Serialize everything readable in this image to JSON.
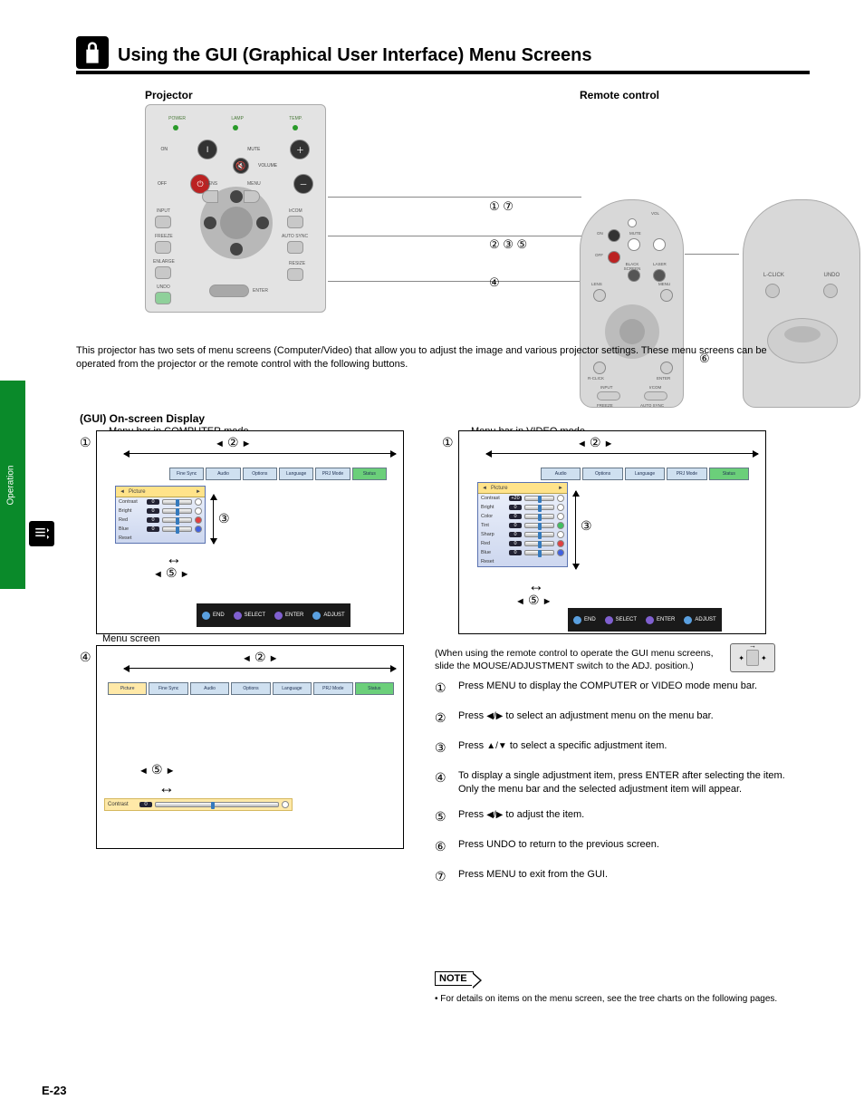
{
  "heading": "Using the GUI (Graphical User Interface) Menu Screens",
  "sidebar_label": "Operation",
  "devices": {
    "panel_caption": "Projector",
    "remote_caption": "Remote control"
  },
  "panel": {
    "status": [
      "POWER",
      "LAMP",
      "TEMP."
    ],
    "top_buttons": {
      "on": "ON",
      "mute": "MUTE",
      "volume": "VOLUME",
      "off": "OFF"
    },
    "mid_buttons": {
      "lens": "LENS",
      "menu": "MENU",
      "ircom": "IrCOM",
      "autosync": "AUTO SYNC"
    },
    "side_left": [
      "INPUT",
      "FREEZE",
      "ENLARGE",
      "UNDO"
    ],
    "side_right": [
      "RESIZE"
    ],
    "enter": "ENTER"
  },
  "remote_front": {
    "labels": [
      "VOL",
      "ON",
      "MUTE",
      "OFF",
      "BLACK SCREEN",
      "LASER",
      "LENS",
      "MENU",
      "R-CLICK",
      "ENTER",
      "INPUT",
      "IrCOM",
      "FREEZE",
      "AUTO SYNC"
    ]
  },
  "remote_back": {
    "lclick": "L-CLICK",
    "undo": "UNDO"
  },
  "callouts_left": [
    "①  ⑦",
    "②  ③  ⑤",
    "④"
  ],
  "callout6": "⑥",
  "gui_intro": [
    "This projector has two sets of menu screens (Computer/Video) that allow you to adjust the image and various projector settings. These menu screens can be operated from the projector or the remote control with the following buttons."
  ],
  "gui_caption_left": "(GUI) On-screen Display",
  "gui_caption_right": "Menu bar in VIDEO mode",
  "gui_caption_left_mode": "Menu bar in COMPUTER mode",
  "gui3_label": "Menu screen",
  "menu_tabs_computer": [
    "Picture",
    "Fine Sync",
    "Audio",
    "Options",
    "Language",
    "PRJ Mode",
    "Status"
  ],
  "menu_tabs_video": [
    "Picture",
    "Audio",
    "Options",
    "Language",
    "PRJ Mode",
    "Status"
  ],
  "osd_computer": {
    "title": "Picture",
    "rows": [
      {
        "name": "Contrast",
        "val": "0",
        "color": "#ffffff"
      },
      {
        "name": "Bright",
        "val": "0",
        "color": "#ffffff"
      },
      {
        "name": "Red",
        "val": "0",
        "color": "#e04040"
      },
      {
        "name": "Blue",
        "val": "0",
        "color": "#4060e0"
      },
      {
        "name": "Reset",
        "val": "",
        "color": ""
      }
    ]
  },
  "osd_video": {
    "title": "Picture",
    "rows": [
      {
        "name": "Contrast",
        "val": "+20",
        "color": "#ffffff"
      },
      {
        "name": "Bright",
        "val": "0",
        "color": "#ffffff"
      },
      {
        "name": "Color",
        "val": "0",
        "color": "#ffffff"
      },
      {
        "name": "Tint",
        "val": "0",
        "color": "#40c060"
      },
      {
        "name": "Sharp",
        "val": "0",
        "color": "#ffffff"
      },
      {
        "name": "Red",
        "val": "0",
        "color": "#e04040"
      },
      {
        "name": "Blue",
        "val": "0",
        "color": "#4060e0"
      },
      {
        "name": "Reset",
        "val": "",
        "color": ""
      }
    ]
  },
  "hint_bar": [
    {
      "icon": "#5aa0e0",
      "label": "END"
    },
    {
      "icon": "#8060d0",
      "label": "SELECT"
    },
    {
      "icon": "#8060d0",
      "label": "ENTER"
    },
    {
      "icon": "#5aa0e0",
      "label": "ADJUST"
    }
  ],
  "strip_single": {
    "name": "Contrast",
    "val": "0"
  },
  "remote_note": "(When using the remote control to operate the GUI menu screens, slide the MOUSE/ADJUSTMENT switch to the ADJ. position.)",
  "steps": [
    {
      "n": "①",
      "txt": "Press MENU to display the COMPUTER or VIDEO mode menu bar."
    },
    {
      "n": "②",
      "txt": "Press ◀/▶ to select an adjustment menu on the menu bar."
    },
    {
      "n": "③",
      "txt": "Press ▲/▼ to select a specific adjustment item."
    },
    {
      "n": "④",
      "txt": "To display a single adjustment item, press ENTER after selecting the item. Only the menu bar and the selected adjustment item will appear."
    },
    {
      "n": "⑤",
      "txt": "Press ◀/▶ to adjust the item."
    },
    {
      "n": "⑥",
      "txt": "Press UNDO to return to the previous screen."
    },
    {
      "n": "⑦",
      "txt": "Press MENU to exit from the GUI."
    }
  ],
  "note_label": "NOTE",
  "notes": [
    "For details on items on the menu screen, see the tree charts on the following pages."
  ],
  "page_number": "E-23"
}
